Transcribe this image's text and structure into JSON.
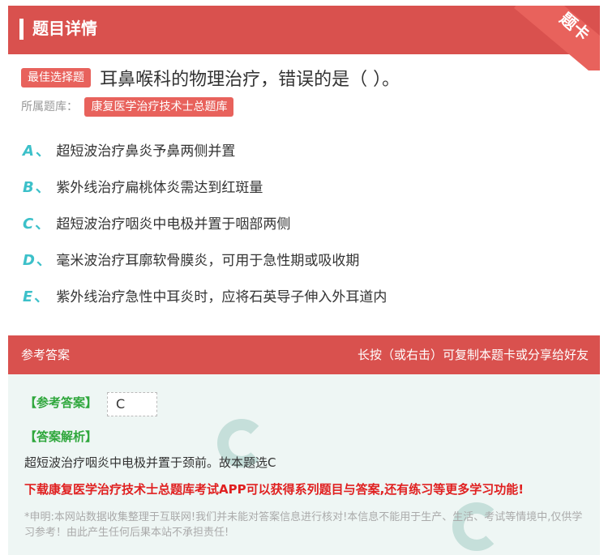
{
  "header": {
    "title": "题目详情",
    "corner_label": "题卡"
  },
  "question": {
    "type_tag": "最佳选择题",
    "text": "耳鼻喉科的物理治疗，错误的是（ ）。",
    "bank_label": "所属题库：",
    "bank_name": "康复医学治疗技术士总题库"
  },
  "options": [
    {
      "letter": "A",
      "text": "超短波治疗鼻炎予鼻两侧并置"
    },
    {
      "letter": "B",
      "text": "紫外线治疗扁桃体炎需达到红斑量"
    },
    {
      "letter": "C",
      "text": "超短波治疗咽炎中电极并置于咽部两侧"
    },
    {
      "letter": "D",
      "text": "毫米波治疗耳廓软骨膜炎，可用于急性期或吸收期"
    },
    {
      "letter": "E",
      "text": "紫外线治疗急性中耳炎时，应将石英导子伸入外耳道内"
    }
  ],
  "option_sep": "、",
  "answer_header": {
    "left": "参考答案",
    "right": "长按（或右击）可复制本题卡或分享给好友"
  },
  "answer": {
    "answer_label": "【参考答案】",
    "answer_value": "C",
    "explain_label": "【答案解析】",
    "explain_text": "超短波治疗咽炎中电极并置于颈前。故本题选C",
    "promo": "下载康复医学治疗技术士总题库考试APP可以获得系列题目与答案,还有练习等更多学习功能!",
    "note": "*申明:本网站数据收集整理于互联网!我们并未能对答案信息进行核对!本信息不能用于生产、生活、考试等情境中,仅供学习参考！由此产生任何后果本站不承担责任!"
  },
  "colors": {
    "accent": "#d9514e",
    "tag": "#e8625c",
    "option_letter": "#3cc0c9",
    "answer_label": "#2fa73c",
    "promo": "#e02020",
    "answer_bg": "#eef6f4"
  }
}
